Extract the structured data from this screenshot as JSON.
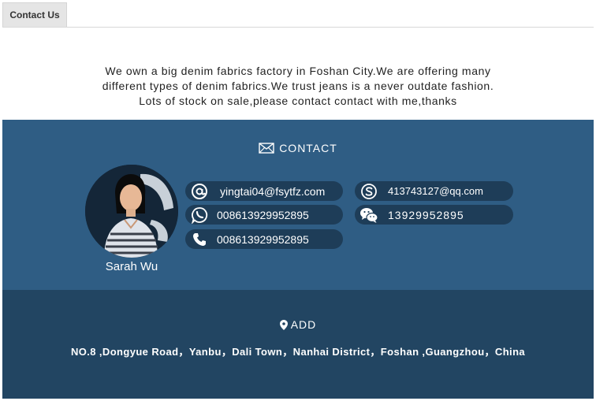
{
  "tab": {
    "label": "Contact Us"
  },
  "intro": {
    "lines": [
      "We own a big denim fabrics factory in Foshan City.We are offering many",
      "different types of denim fabrics.We trust jeans is a never outdate fashion.",
      "Lots of stock on sale,please contact contact with me,thanks"
    ]
  },
  "contact": {
    "heading": "CONTACT",
    "name": "Sarah Wu",
    "email": "yingtai04@fsytfz.com",
    "whatsapp": "008613929952895",
    "phone": "008613929952895",
    "skype": "413743127@qq.com",
    "wechat": "13929952895"
  },
  "address_section": {
    "heading": "ADD",
    "address": "NO.8 ,Dongyue Road，Yanbu，Dali Town，Nanhai District，Foshan ,Guangzhou，China"
  },
  "colors": {
    "contact_bg": "#2f5d84",
    "pill_bg": "#1e3d58",
    "address_bg": "#224562"
  },
  "icons": [
    "mail-icon",
    "at-icon",
    "whatsapp-icon",
    "phone-icon",
    "skype-icon",
    "wechat-icon",
    "location-pin-icon"
  ]
}
